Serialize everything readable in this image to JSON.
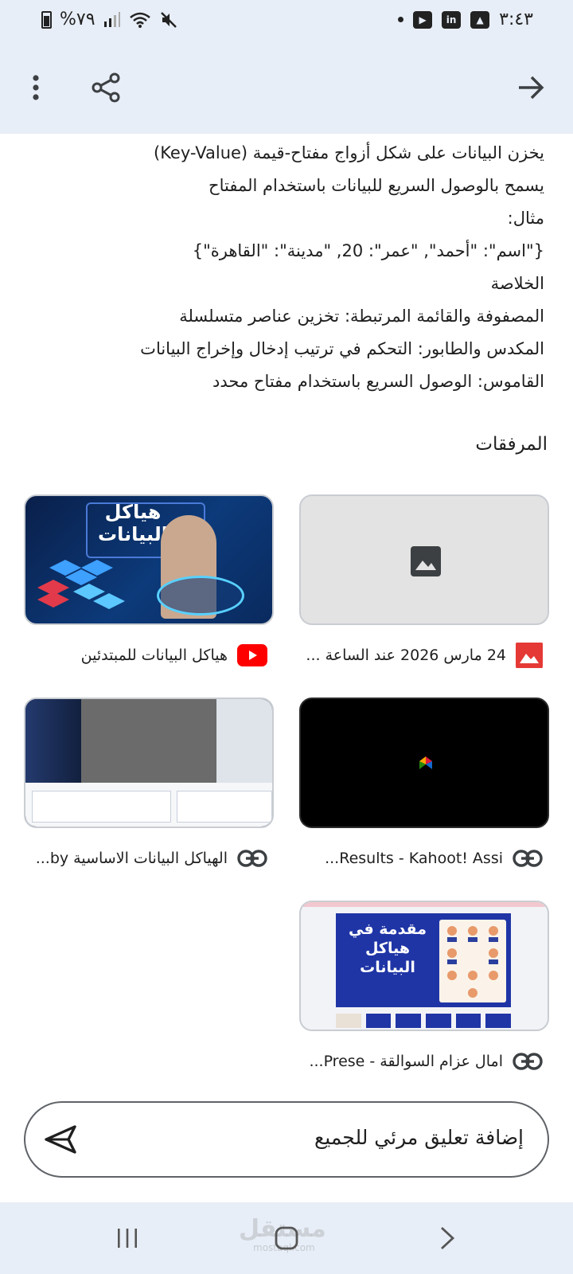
{
  "status_bar": {
    "battery_text": "%٧٩",
    "time": "٣:٤٣"
  },
  "toolbar": {
    "more_icon": "more-vert-icon",
    "share_icon": "share-icon",
    "forward_icon": "arrow-forward-icon"
  },
  "content": {
    "lines": [
      "يخزن البيانات على شكل أزواج مفتاح-قيمة (Key-Value)",
      "يسمح بالوصول السريع للبيانات باستخدام المفتاح",
      "مثال:",
      "{\"اسم\": \"أحمد\", \"عمر\": 20, \"مدينة\": \"القاهرة\"}",
      "الخلاصة",
      "المصفوفة والقائمة المرتبطة: تخزين عناصر متسلسلة",
      "المكدس والطابور: التحكم في ترتيب إدخال وإخراج البيانات",
      "القاموس: الوصول السريع باستخدام مفتاح محدد"
    ]
  },
  "attachments": {
    "title": "المرفقات",
    "items": [
      {
        "caption": "24 مارس 2026 عند الساعة ...",
        "icon": "image-icon",
        "thumb_text": ""
      },
      {
        "caption": "هياكل البيانات للمبتدئين",
        "icon": "youtube-icon",
        "thumb_text": "هياكل البيانات"
      },
      {
        "caption": "Results - Kahoot! Assi...",
        "icon": "link-icon",
        "thumb_text": ""
      },
      {
        "caption": "الهياكل البيانات الاساسية by...",
        "icon": "link-icon",
        "thumb_text": ""
      },
      {
        "caption": "امال عزام السوالقة - Prese...",
        "icon": "link-icon",
        "thumb_text": "مقدمة في هياكل البيانات"
      }
    ]
  },
  "comment": {
    "placeholder": "إضافة تعليق مرئي للجميع"
  },
  "watermark": {
    "text": "مستقل",
    "sub": "mostaql.com"
  },
  "colors": {
    "bar_bg": "#e8eef7",
    "youtube_red": "#ff0000",
    "image_red": "#e53935",
    "thumb_border": "#c9cdd2"
  }
}
